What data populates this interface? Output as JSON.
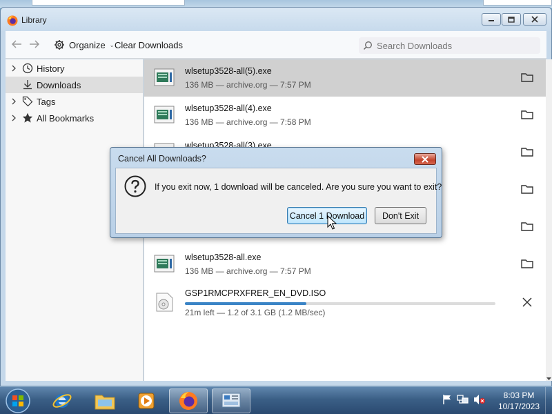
{
  "window": {
    "title": "Library"
  },
  "toolbar": {
    "organize_label": "Organize",
    "clear_label": "Clear Downloads",
    "search_placeholder": "Search Downloads"
  },
  "sidebar": {
    "items": [
      {
        "label": "History",
        "icon": "clock-icon",
        "expandable": true,
        "selected": false
      },
      {
        "label": "Downloads",
        "icon": "download-icon",
        "expandable": false,
        "selected": true
      },
      {
        "label": "Tags",
        "icon": "tag-icon",
        "expandable": true,
        "selected": false
      },
      {
        "label": "All Bookmarks",
        "icon": "star-icon",
        "expandable": true,
        "selected": false
      }
    ]
  },
  "downloads": [
    {
      "name": "wlsetup3528-all(5).exe",
      "meta": "136 MB — archive.org — 7:57 PM",
      "selected": true
    },
    {
      "name": "wlsetup3528-all(4).exe",
      "meta": "136 MB — archive.org — 7:58 PM",
      "selected": false
    },
    {
      "name": "wlsetup3528-all(3).exe",
      "meta": "",
      "selected": false
    },
    {
      "name": "",
      "meta": "",
      "selected": false
    },
    {
      "name": "",
      "meta": "",
      "selected": false
    },
    {
      "name": "wlsetup3528-all.exe",
      "meta": "136 MB — archive.org — 7:57 PM",
      "selected": false
    },
    {
      "name": "GSP1RMCPRXFRER_EN_DVD.ISO",
      "meta": "21m left — 1.2 of 3.1 GB (1.2 MB/sec)",
      "progress": 0.39,
      "in_progress": true
    }
  ],
  "dialog": {
    "title": "Cancel All Downloads?",
    "message": "If you exit now, 1 download will be canceled. Are you sure you want to exit?",
    "confirm_label": "Cancel 1 Download",
    "cancel_label": "Don't Exit"
  },
  "taskbar": {
    "apps": [
      "internet-explorer-icon",
      "file-explorer-icon",
      "media-player-icon",
      "firefox-icon",
      "control-panel-icon"
    ],
    "active_app": "firefox-icon",
    "time": "8:03 PM",
    "date": "10/17/2023"
  },
  "colors": {
    "accent": "#3a84c6",
    "selected_row": "#d0d0d0",
    "dialog_frame": "#c9dcee"
  }
}
